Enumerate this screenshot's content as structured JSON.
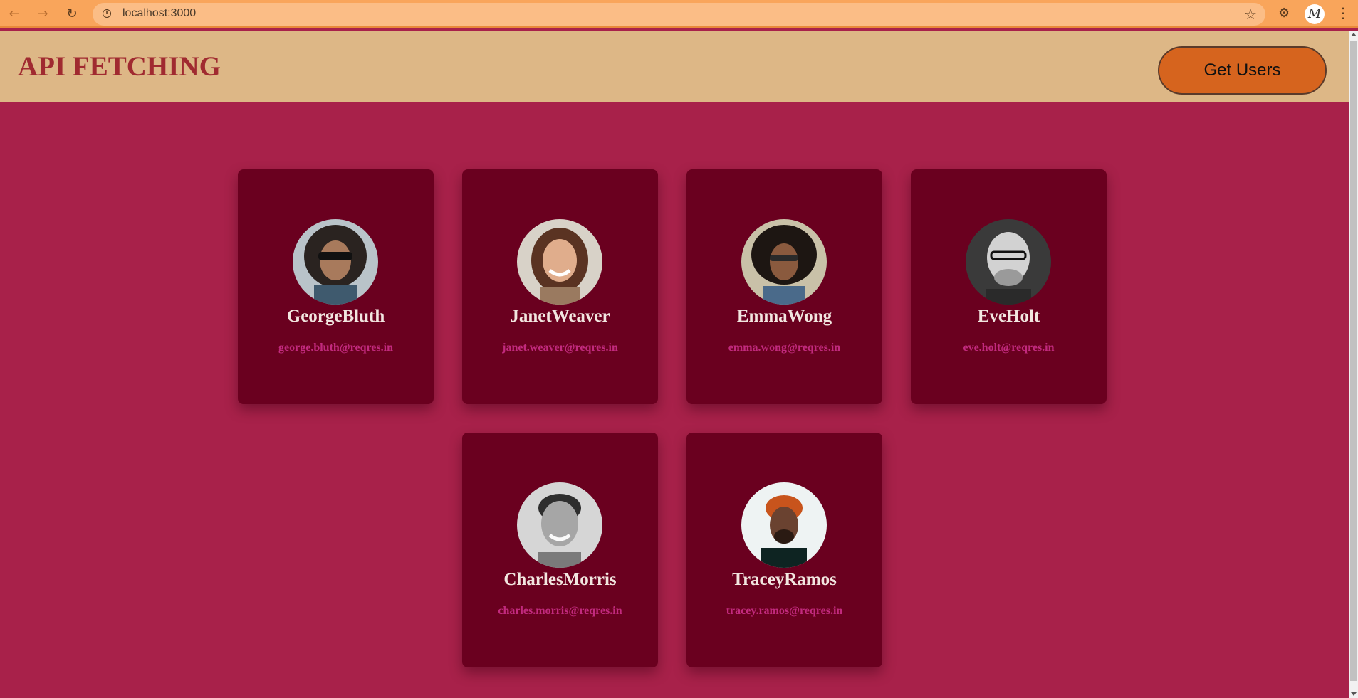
{
  "browser": {
    "url": "localhost:3000",
    "back_icon": "arrow-left-icon",
    "forward_icon": "arrow-right-icon",
    "reload_icon": "reload-icon",
    "profile_initial": "M"
  },
  "header": {
    "title": "API FETCHING",
    "button_label": "Get Users"
  },
  "colors": {
    "page_bg": "#a8214a",
    "header_bg": "#ddb786",
    "card_bg": "#6a001f",
    "title": "#a02a30",
    "button_bg": "#d6641e",
    "email": "#c22a7e",
    "chrome_bg": "#f9a55b"
  },
  "users": [
    {
      "name": "GeorgeBluth",
      "email": "george.bluth@reqres.in"
    },
    {
      "name": "JanetWeaver",
      "email": "janet.weaver@reqres.in"
    },
    {
      "name": "EmmaWong",
      "email": "emma.wong@reqres.in"
    },
    {
      "name": "EveHolt",
      "email": "eve.holt@reqres.in"
    },
    {
      "name": "CharlesMorris",
      "email": "charles.morris@reqres.in"
    },
    {
      "name": "TraceyRamos",
      "email": "tracey.ramos@reqres.in"
    }
  ]
}
